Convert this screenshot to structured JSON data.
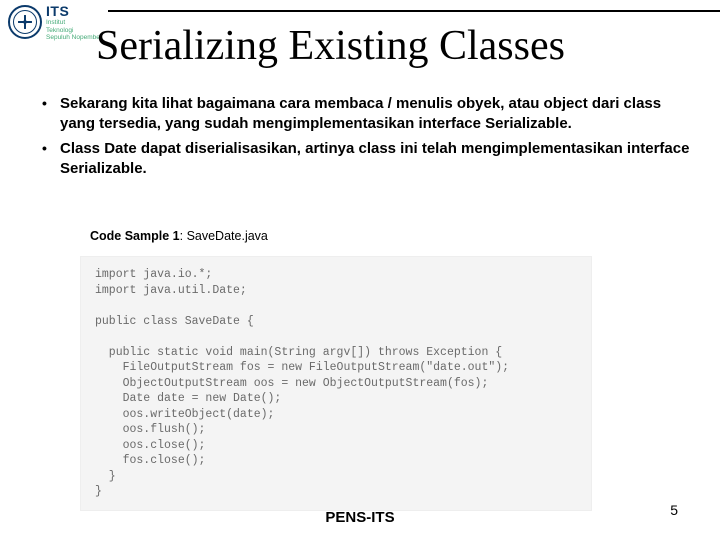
{
  "logo": {
    "abbr": "ITS",
    "line1": "Institut",
    "line2": "Teknologi",
    "line3": "Sepuluh Nopember"
  },
  "title": "Serializing Existing Classes",
  "bullets": [
    "Sekarang kita lihat bagaimana cara membaca / menulis obyek, atau object dari class yang tersedia, yang sudah mengimplementasikan interface Serializable.",
    "Class Date dapat diserialisasikan, artinya class ini telah mengimplementasikan interface Serializable."
  ],
  "code_caption_label": "Code Sample 1",
  "code_caption_file": ": SaveDate.java",
  "code": "import java.io.*;\nimport java.util.Date;\n\npublic class SaveDate {\n\n  public static void main(String argv[]) throws Exception {\n    FileOutputStream fos = new FileOutputStream(\"date.out\");\n    ObjectOutputStream oos = new ObjectOutputStream(fos);\n    Date date = new Date();\n    oos.writeObject(date);\n    oos.flush();\n    oos.close();\n    fos.close();\n  }\n}",
  "footer": "PENS-ITS",
  "page_number": "5"
}
